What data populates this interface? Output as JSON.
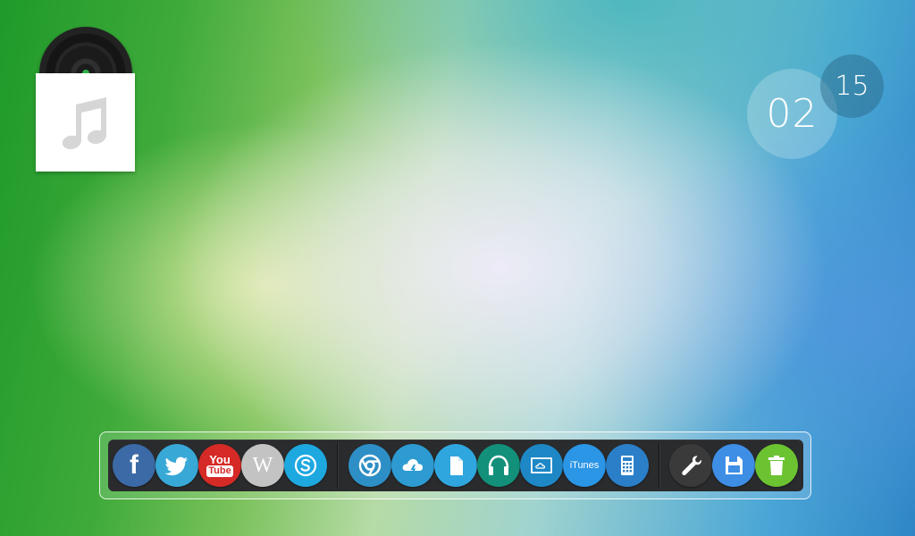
{
  "clock": {
    "hours": "02",
    "minutes": "15"
  },
  "music_widget": {
    "icon": "music-note-icon"
  },
  "dock": {
    "groups": [
      {
        "items": [
          {
            "name": "facebook",
            "label": "f",
            "color": "#3b6aa6"
          },
          {
            "name": "twitter",
            "color": "#38a8d6"
          },
          {
            "name": "youtube",
            "label_top": "You",
            "label_bottom": "Tube",
            "color": "#d62a27"
          },
          {
            "name": "wikipedia",
            "label": "W",
            "color": "#c3c3c3"
          },
          {
            "name": "skype",
            "color": "#1ea8e0"
          }
        ]
      },
      {
        "items": [
          {
            "name": "chrome",
            "color": "#2d8fc5"
          },
          {
            "name": "cloud-storm",
            "color": "#2d9bd2"
          },
          {
            "name": "document",
            "color": "#2fa6de"
          },
          {
            "name": "headphones",
            "color": "#12907a"
          },
          {
            "name": "screen-cloud",
            "color": "#1e87c6"
          },
          {
            "name": "itunes",
            "label": "iTunes",
            "color": "#2b95e6"
          },
          {
            "name": "calculator",
            "color": "#2a7fc8"
          }
        ]
      },
      {
        "items": [
          {
            "name": "settings-wrench",
            "color": "#3a3a3a"
          },
          {
            "name": "save-floppy",
            "color": "#3e8ee6"
          },
          {
            "name": "trash",
            "color": "#6cc331"
          }
        ]
      }
    ]
  }
}
